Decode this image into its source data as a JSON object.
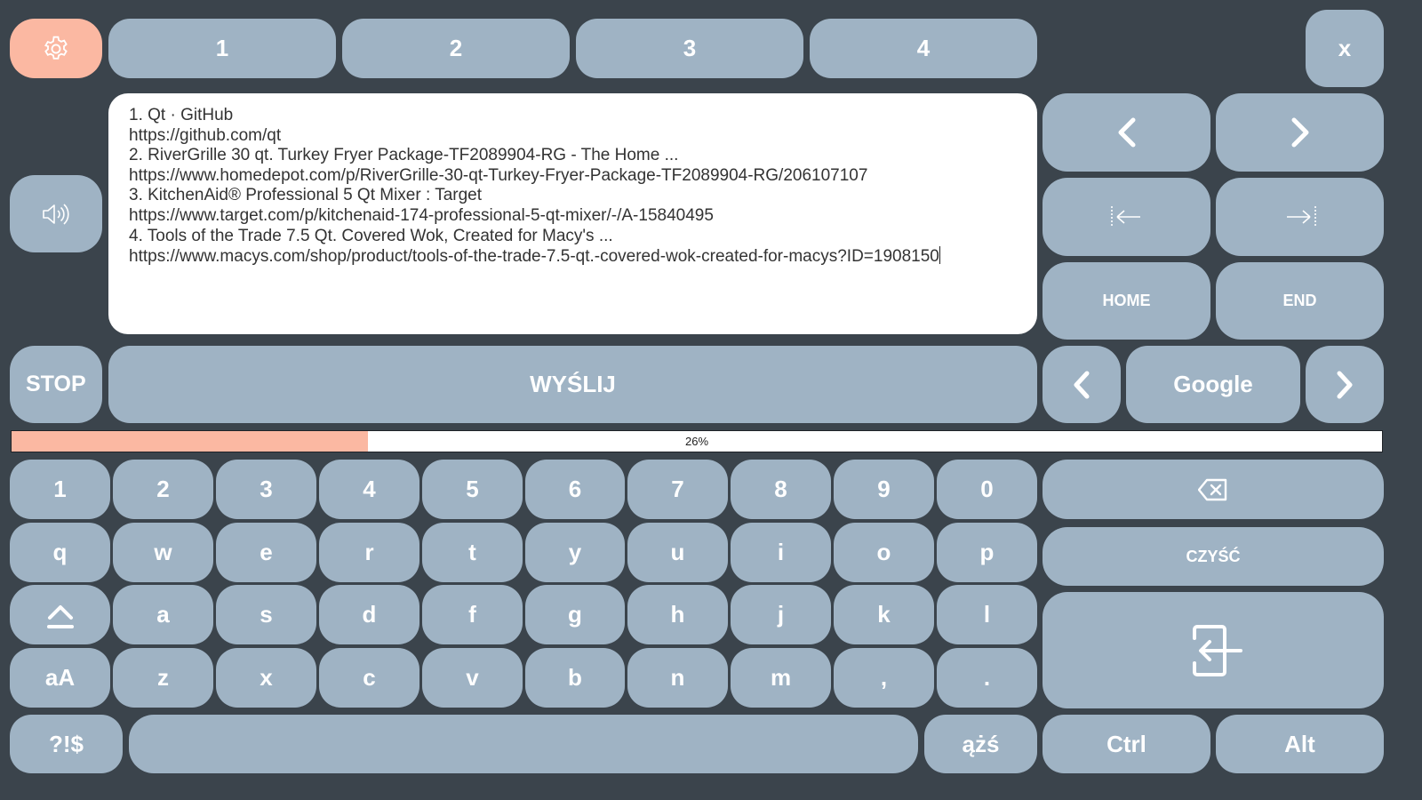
{
  "top_tabs": [
    "1",
    "2",
    "3",
    "4"
  ],
  "close_label": "x",
  "text_lines": [
    "1. Qt · GitHub",
    "https://github.com/qt",
    "2. RiverGrille 30 qt. Turkey Fryer Package-TF2089904-RG - The Home ...",
    "https://www.homedepot.com/p/RiverGrille-30-qt-Turkey-Fryer-Package-TF2089904-RG/206107107",
    "3. KitchenAid® Professional 5 Qt Mixer : Target",
    "https://www.target.com/p/kitchenaid-174-professional-5-qt-mixer/-/A-15840495",
    "4. Tools of the Trade 7.5 Qt. Covered Wok, Created for Macy's ...",
    "https://www.macys.com/shop/product/tools-of-the-trade-7.5-qt.-covered-wok-created-for-macys?ID=1908150"
  ],
  "nav": {
    "home_label": "HOME",
    "end_label": "END"
  },
  "stop_label": "STOP",
  "send_label": "WYŚLIJ",
  "engine_label": "Google",
  "progress": {
    "value": 0.26,
    "label": "26%"
  },
  "keys": {
    "row1": [
      "1",
      "2",
      "3",
      "4",
      "5",
      "6",
      "7",
      "8",
      "9",
      "0"
    ],
    "row2": [
      "q",
      "w",
      "e",
      "r",
      "t",
      "y",
      "u",
      "i",
      "o",
      "p"
    ],
    "row3": [
      "a",
      "s",
      "d",
      "f",
      "g",
      "h",
      "j",
      "k",
      "l"
    ],
    "row4_case": "aA",
    "row4": [
      "z",
      "x",
      "c",
      "v",
      "b",
      "n",
      "m",
      ",",
      "."
    ],
    "symbols": "?!$",
    "polish": "ążś",
    "ctrl": "Ctrl",
    "alt": "Alt",
    "clear": "CZYŚĆ"
  },
  "icons": {
    "settings": "gear-icon",
    "speaker": "speaker-icon",
    "backspace": "backspace-icon",
    "shift": "shift-icon",
    "enter": "enter-icon"
  },
  "colors": {
    "background": "#3b444c",
    "key": "#9fb3c4",
    "accent": "#fbb8a2",
    "text_area": "#ffffff"
  }
}
